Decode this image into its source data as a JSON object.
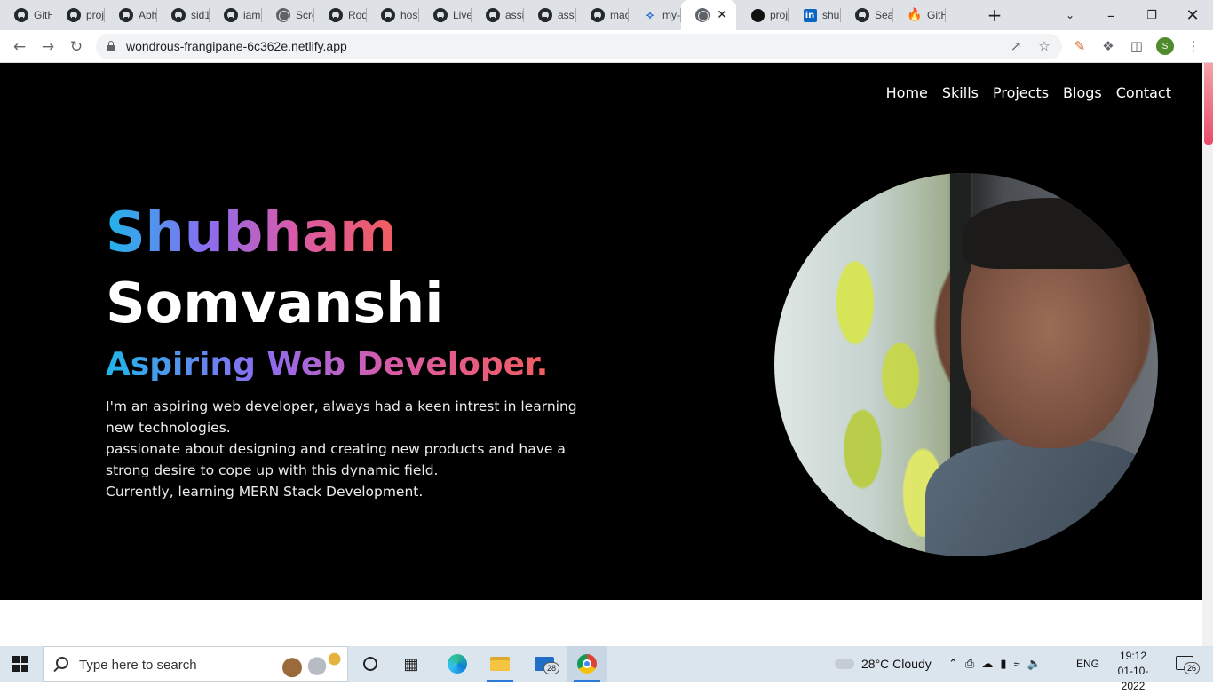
{
  "browser": {
    "tabs": [
      {
        "label": "GitH",
        "icon": "github-icon"
      },
      {
        "label": "proj",
        "icon": "github-icon"
      },
      {
        "label": "Abh",
        "icon": "github-icon"
      },
      {
        "label": "sid1",
        "icon": "github-icon"
      },
      {
        "label": "iam",
        "icon": "github-icon"
      },
      {
        "label": "Scre",
        "icon": "globe-icon"
      },
      {
        "label": "Rod",
        "icon": "github-icon"
      },
      {
        "label": "host",
        "icon": "github-icon"
      },
      {
        "label": "Live",
        "icon": "github-icon"
      },
      {
        "label": "assi",
        "icon": "github-icon"
      },
      {
        "label": "assi",
        "icon": "github-icon"
      },
      {
        "label": "mac",
        "icon": "github-icon"
      },
      {
        "label": "my-",
        "icon": "netlify-icon"
      },
      {
        "label": "",
        "icon": "globe-icon",
        "active": true
      },
      {
        "label": "proj",
        "icon": "app-icon"
      },
      {
        "label": "shu",
        "icon": "linkedin-icon"
      },
      {
        "label": "Sea",
        "icon": "github-icon"
      },
      {
        "label": "GitH",
        "icon": "flame-icon"
      }
    ],
    "url": "wondrous-frangipane-6c362e.netlify.app",
    "profile_initial": "S"
  },
  "site": {
    "nav": [
      "Home",
      "Skills",
      "Projects",
      "Blogs",
      "Contact"
    ],
    "first_name": "Shubham",
    "last_name": "Somvanshi",
    "role": "Aspiring Web Developer.",
    "description_lines": [
      "I'm an aspiring web developer, always had a keen intrest in learning new technologies.",
      "passionate about designing and creating new products and have a strong desire to cope up with this dynamic field.",
      "Currently, learning MERN Stack Development."
    ],
    "colors": {
      "gradient_start": "#1fb5ea",
      "gradient_mid": "#a66fe6",
      "gradient_end": "#f25d5d",
      "background": "#000000"
    }
  },
  "taskbar": {
    "search_placeholder": "Type here to search",
    "mail_badge": "28",
    "weather": "28°C  Cloudy",
    "language": "ENG",
    "time": "19:12",
    "date": "01-10-2022",
    "notifications": "26"
  }
}
